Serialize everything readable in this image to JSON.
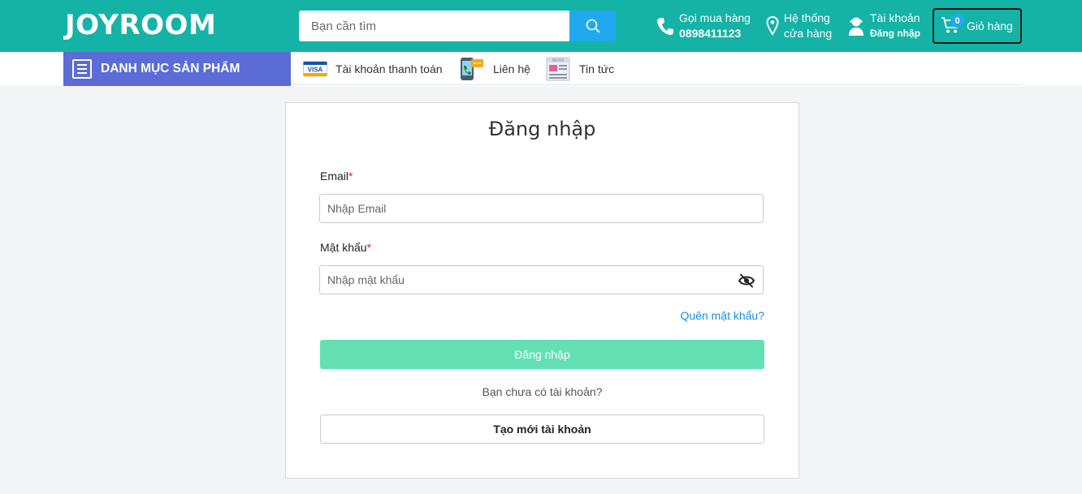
{
  "brand": {
    "logo_text": "JOYROOM",
    "primary_color": "#14b3a6",
    "accent_color": "#21a9ef",
    "category_color": "#5b6cd6",
    "login_button_color": "#63e1b3"
  },
  "header": {
    "search": {
      "placeholder": "Bạn cần tìm",
      "value": ""
    },
    "phone": {
      "label": "Gọi mua hàng",
      "number": "0898411123"
    },
    "store": {
      "line1": "Hệ thống",
      "line2": "cửa hàng"
    },
    "account": {
      "label": "Tài khoản",
      "sub": "Đăng nhập"
    },
    "cart": {
      "count": "0",
      "label": "Giỏ hàng"
    }
  },
  "nav": {
    "category_label": "DANH MỤC SẢN PHẨM",
    "links": [
      {
        "label": "Tài khoản thanh toán",
        "icon": "visa-card-icon"
      },
      {
        "label": "Liên hệ",
        "icon": "contact-phone-icon"
      },
      {
        "label": "Tin tức",
        "icon": "newspaper-icon"
      }
    ]
  },
  "login": {
    "title": "Đăng nhập",
    "email_label": "Email",
    "email_placeholder": "Nhập Email",
    "password_label": "Mật khẩu",
    "password_placeholder": "Nhập mật khẩu",
    "required_mark": "*",
    "forgot_label": "Quên mật khẩu?",
    "submit_label": "Đăng nhập",
    "no_account_text": "Bạn chưa có tài khoản?",
    "create_label": "Tạo mới tài khoản"
  }
}
